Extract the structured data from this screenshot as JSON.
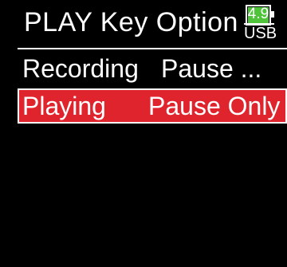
{
  "header": {
    "title": "PLAY Key Option",
    "battery": {
      "level": "4.9",
      "source": "USB",
      "fill_color": "#4fc43a",
      "icon": "battery-icon"
    }
  },
  "options": [
    {
      "label": "Recording",
      "value": "Pause ...",
      "selected": false
    },
    {
      "label": "Playing",
      "value": "Pause Only",
      "selected": true
    }
  ],
  "colors": {
    "background": "#000000",
    "text": "#ffffff",
    "selection": "#e0242d"
  }
}
